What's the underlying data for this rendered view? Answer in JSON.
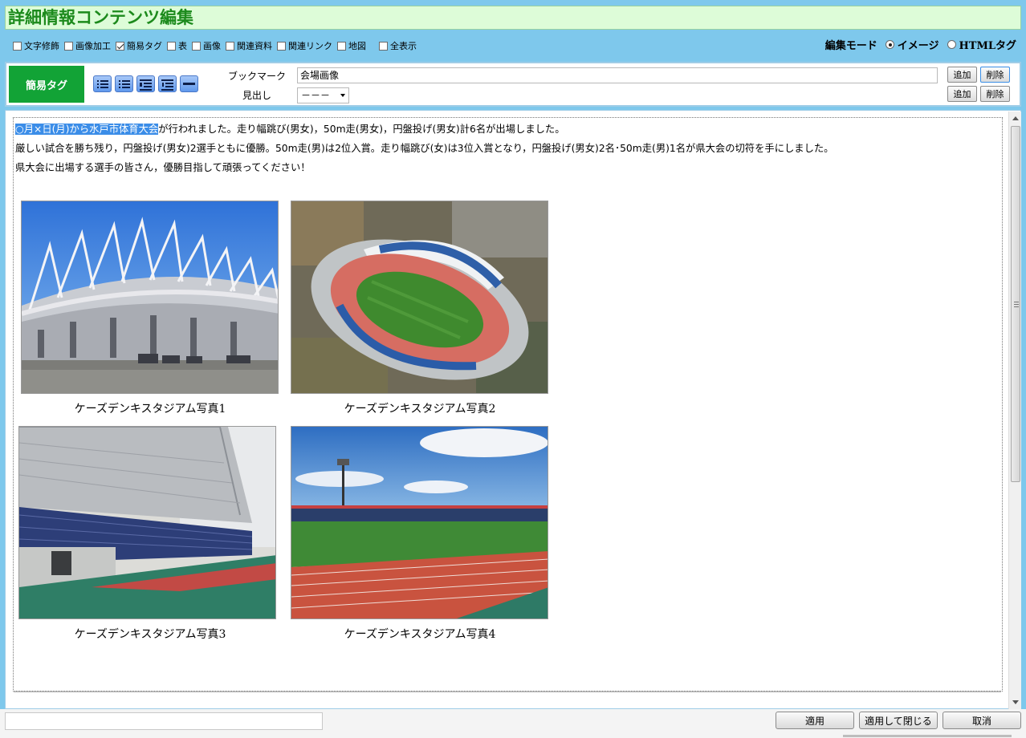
{
  "title": "詳細情報コンテンツ編集",
  "options": [
    {
      "label": "文字修飾",
      "checked": false
    },
    {
      "label": "画像加工",
      "checked": false
    },
    {
      "label": "簡易タグ",
      "checked": true
    },
    {
      "label": "表",
      "checked": false
    },
    {
      "label": "画像",
      "checked": false
    },
    {
      "label": "関連資料",
      "checked": false
    },
    {
      "label": "関連リンク",
      "checked": false
    },
    {
      "label": "地図",
      "checked": false
    }
  ],
  "show_all": {
    "label": "全表示",
    "checked": false
  },
  "edit_mode": {
    "label": "編集モード",
    "options": [
      {
        "label": "イメージ",
        "selected": true
      },
      {
        "label": "HTMLタグ",
        "selected": false
      }
    ]
  },
  "toolbar": {
    "section_label": "簡易タグ",
    "bookmark_label": "ブックマーク",
    "bookmark_value": "会場画像",
    "heading_label": "見出し",
    "heading_value": "－－－",
    "add_label": "追加",
    "delete_label": "削除",
    "format_icons": [
      "ordered-list-icon",
      "unordered-list-icon",
      "indent-icon",
      "outdent-icon",
      "horizontal-rule-icon"
    ]
  },
  "content": {
    "line1_selected": "○月×日(月)から水戸市体育大会",
    "line1_rest": "が行われました。走り幅跳び(男女)，50m走(男女)，円盤投げ(男女)計6名が出場しました。",
    "line2": "厳しい試合を勝ち残り，円盤投げ(男女)2選手ともに優勝。50m走(男)は2位入賞。走り幅跳び(女)は3位入賞となり，円盤投げ(男女)2名･50m走(男)1名が県大会の切符を手にしました。",
    "line3": "県大会に出場する選手の皆さん，優勝目指して頑張ってください！",
    "photos": [
      {
        "caption": "ケーズデンキスタジアム写真1"
      },
      {
        "caption": "ケーズデンキスタジアム写真2"
      },
      {
        "caption": "ケーズデンキスタジアム写真3"
      },
      {
        "caption": "ケーズデンキスタジアム写真4"
      }
    ]
  },
  "footer": {
    "apply": "適用",
    "apply_close": "適用して閉じる",
    "cancel": "取消"
  }
}
